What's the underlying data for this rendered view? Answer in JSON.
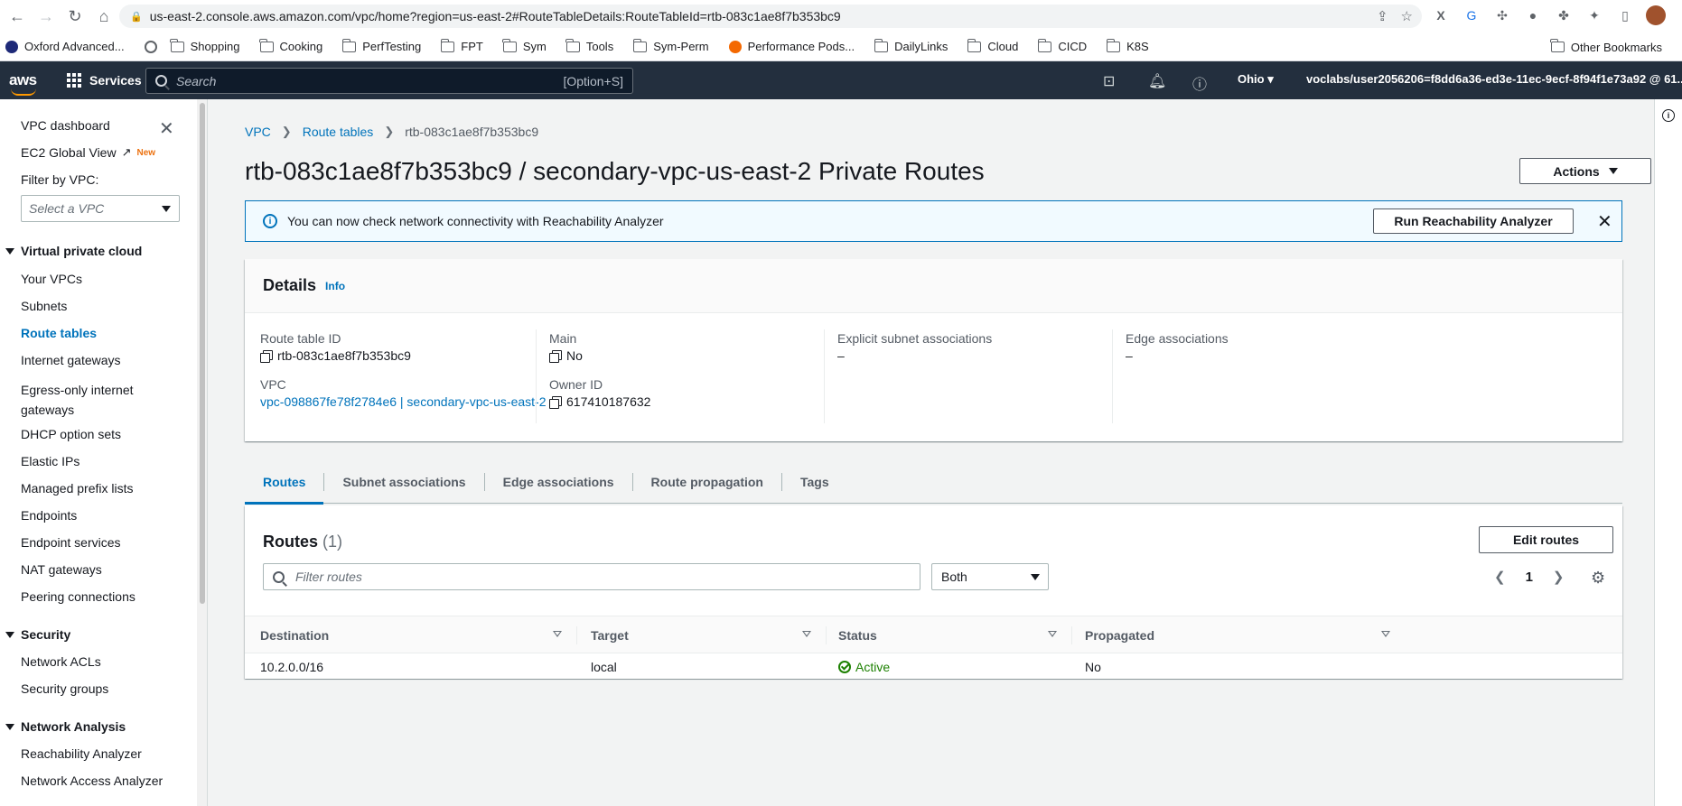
{
  "browser": {
    "url": "us-east-2.console.aws.amazon.com/vpc/home?region=us-east-2#RouteTableDetails:RouteTableId=rtb-083c1ae8f7b353bc9",
    "bookmarks": [
      "Oxford Advanced...",
      "Shopping",
      "Cooking",
      "PerfTesting",
      "FPT",
      "Sym",
      "Tools",
      "Sym-Perm",
      "Performance Pods...",
      "DailyLinks",
      "Cloud",
      "CICD",
      "K8S"
    ],
    "other_bookmarks": "Other Bookmarks"
  },
  "aws_nav": {
    "logo": "aws",
    "services": "Services",
    "search_placeholder": "Search",
    "search_hint": "[Option+S]",
    "region": "Ohio",
    "account": "voclabs/user2056206=f8dd6a36-ed3e-11ec-9ecf-8f94f1e73a92 @ 61..."
  },
  "sidebar": {
    "vpc_dashboard": "VPC dashboard",
    "ec2_global_view": "EC2 Global View",
    "new_badge": "New",
    "filter_label": "Filter by VPC:",
    "select_placeholder": "Select a VPC",
    "sections": [
      {
        "title": "Virtual private cloud",
        "items": [
          "Your VPCs",
          "Subnets",
          "Route tables",
          "Internet gateways",
          "Egress-only internet gateways",
          "DHCP option sets",
          "Elastic IPs",
          "Managed prefix lists",
          "Endpoints",
          "Endpoint services",
          "NAT gateways",
          "Peering connections"
        ]
      },
      {
        "title": "Security",
        "items": [
          "Network ACLs",
          "Security groups"
        ]
      },
      {
        "title": "Network Analysis",
        "items": [
          "Reachability Analyzer",
          "Network Access Analyzer"
        ]
      }
    ],
    "egress_line1": "Egress-only internet",
    "egress_line2": "gateways"
  },
  "breadcrumb": [
    "VPC",
    "Route tables",
    "rtb-083c1ae8f7b353bc9"
  ],
  "page_title": "rtb-083c1ae8f7b353bc9 / secondary-vpc-us-east-2 Private Routes",
  "actions_label": "Actions",
  "flash": {
    "text": "You can now check network connectivity with Reachability Analyzer",
    "button": "Run Reachability Analyzer"
  },
  "details": {
    "title": "Details",
    "info": "Info",
    "route_table_id_label": "Route table ID",
    "route_table_id": "rtb-083c1ae8f7b353bc9",
    "vpc_label": "VPC",
    "vpc_value": "vpc-098867fe78f2784e6 | secondary-vpc-us-east-2",
    "main_label": "Main",
    "main_value": "No",
    "owner_label": "Owner ID",
    "owner_value": "617410187632",
    "explicit_label": "Explicit subnet associations",
    "explicit_value": "–",
    "edge_label": "Edge associations",
    "edge_value": "–"
  },
  "tabs": [
    "Routes",
    "Subnet associations",
    "Edge associations",
    "Route propagation",
    "Tags"
  ],
  "routes": {
    "title": "Routes",
    "count": "(1)",
    "edit_button": "Edit routes",
    "filter_placeholder": "Filter routes",
    "scope_select": "Both",
    "page": "1",
    "columns": [
      "Destination",
      "Target",
      "Status",
      "Propagated"
    ],
    "rows": [
      {
        "destination": "10.2.0.0/16",
        "target": "local",
        "status": "Active",
        "propagated": "No"
      }
    ]
  },
  "colors": {
    "accent": "#0073bb",
    "nav_bg": "#232f3e",
    "success": "#1d8102",
    "aws_orange": "#ff9900"
  }
}
